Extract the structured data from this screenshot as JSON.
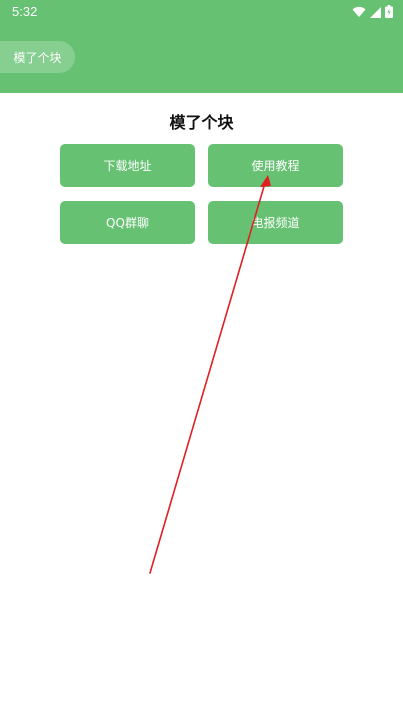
{
  "status_bar": {
    "time": "5:32",
    "icons": [
      "wifi-icon",
      "signal-icon",
      "battery-icon"
    ]
  },
  "app_bar": {
    "title": "模了个块"
  },
  "main": {
    "heading": "模了个块",
    "buttons": [
      {
        "label": "下载地址"
      },
      {
        "label": "使用教程"
      },
      {
        "label": "QQ群聊"
      },
      {
        "label": "电报频道"
      }
    ]
  },
  "colors": {
    "accent": "#66c272",
    "annotation_arrow": "#e02020"
  }
}
